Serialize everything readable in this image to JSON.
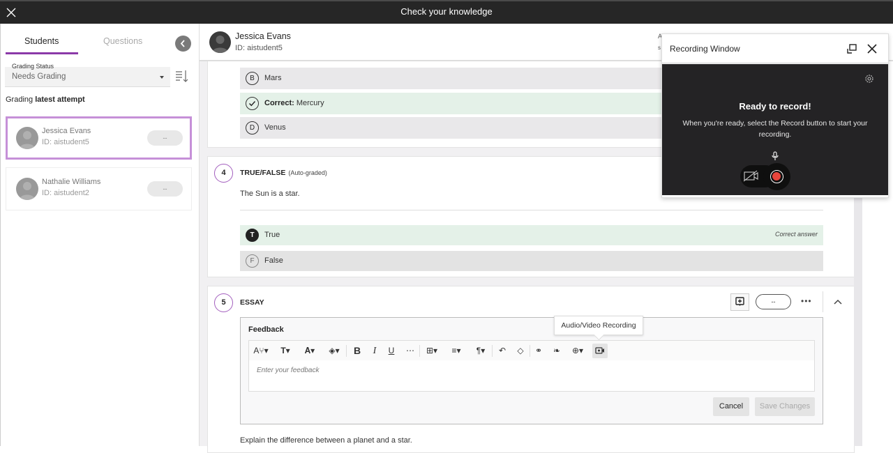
{
  "topbar": {
    "title": "Check your knowledge"
  },
  "sidebar": {
    "tabs": [
      {
        "label": "Students",
        "active": true
      },
      {
        "label": "Questions",
        "active": false
      }
    ],
    "grading_status": {
      "label": "Grading Status",
      "value": "Needs Grading"
    },
    "grading_attempt": {
      "prefix": "Grading",
      "bold": "latest attempt"
    },
    "students": [
      {
        "name": "Jessica Evans",
        "id": "ID: aistudent5",
        "grade": "--",
        "selected": true
      },
      {
        "name": "Nathalie Williams",
        "id": "ID: aistudent2",
        "grade": "--",
        "selected": false
      }
    ]
  },
  "header": {
    "name": "Jessica Evans",
    "id": "ID: aistudent5",
    "partial_line1": "A",
    "partial_line2": "s"
  },
  "question3": {
    "options": [
      {
        "letter": "B",
        "text": "Mars"
      },
      {
        "letter": "",
        "correct_label": "Correct:",
        "text": "Mercury"
      },
      {
        "letter": "D",
        "text": "Venus"
      }
    ]
  },
  "question4": {
    "number": "4",
    "type": "TRUE/FALSE",
    "type_note": "(Auto-graded)",
    "text": "The Sun is a star.",
    "options": [
      {
        "letter": "T",
        "text": "True",
        "note": "Correct answer"
      },
      {
        "letter": "F",
        "text": "False"
      }
    ]
  },
  "question5": {
    "number": "5",
    "type": "ESSAY",
    "score": "--",
    "more": "•••",
    "feedback": {
      "label": "Feedback",
      "placeholder": "Enter your feedback",
      "cancel": "Cancel",
      "save": "Save Changes"
    },
    "text": "Explain the difference between a planet and a star."
  },
  "tooltip": {
    "text": "Audio/Video Recording"
  },
  "recording_window": {
    "title": "Recording Window",
    "heading": "Ready to record!",
    "description": "When you're ready, select the Record button to start your recording.",
    "record_color": "#e8453c"
  },
  "accent_color": "#8b3aa8"
}
